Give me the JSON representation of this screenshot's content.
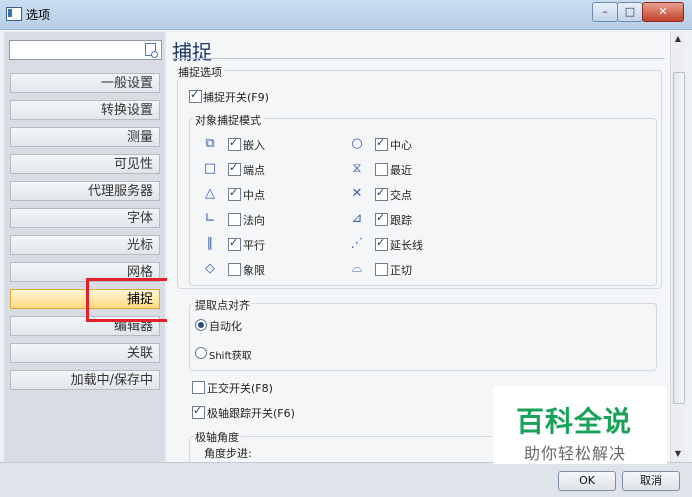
{
  "window": {
    "title": "选项"
  },
  "search": {
    "value": ""
  },
  "sidebar": {
    "items": [
      {
        "label": "一般设置"
      },
      {
        "label": "转换设置"
      },
      {
        "label": "测量"
      },
      {
        "label": "可见性"
      },
      {
        "label": "代理服务器"
      },
      {
        "label": "字体"
      },
      {
        "label": "光标"
      },
      {
        "label": "网格"
      },
      {
        "label": "捕捉",
        "selected": true
      },
      {
        "label": "编辑器"
      },
      {
        "label": "关联"
      },
      {
        "label": "加载中/保存中"
      }
    ]
  },
  "main": {
    "heading": "捕捉",
    "snap_options_group": "捕捉选项",
    "snap_toggle": {
      "label": "捕捉开关(F9)",
      "checked": true
    },
    "object_snap_group": "对象捕捉模式",
    "object_snap_left": [
      {
        "label": "嵌入",
        "checked": true,
        "icon": "embed-icon"
      },
      {
        "label": "端点",
        "checked": true,
        "icon": "endpoint-icon"
      },
      {
        "label": "中点",
        "checked": true,
        "icon": "midpoint-icon"
      },
      {
        "label": "法向",
        "checked": false,
        "icon": "perpendicular-icon"
      },
      {
        "label": "平行",
        "checked": true,
        "icon": "parallel-icon"
      },
      {
        "label": "象限",
        "checked": false,
        "icon": "quadrant-icon"
      }
    ],
    "object_snap_right": [
      {
        "label": "中心",
        "checked": true,
        "icon": "center-icon"
      },
      {
        "label": "最近",
        "checked": false,
        "icon": "nearest-icon"
      },
      {
        "label": "交点",
        "checked": true,
        "icon": "intersection-icon"
      },
      {
        "label": "跟踪",
        "checked": true,
        "icon": "tracking-icon"
      },
      {
        "label": "延长线",
        "checked": true,
        "icon": "extension-icon"
      },
      {
        "label": "正切",
        "checked": false,
        "icon": "tangent-icon"
      }
    ],
    "pick_align_group": "提取点对齐",
    "pick_align_options": [
      {
        "label": "自动化",
        "selected": true
      },
      {
        "label": "Shift获取",
        "selected": false
      }
    ],
    "ortho": {
      "label": "正交开关(F8)",
      "checked": false
    },
    "polar": {
      "label": "极轴跟踪开关(F6)",
      "checked": true
    },
    "polar_angle_group": "极轴角度",
    "angle_step_label": "角度步进:"
  },
  "buttons": {
    "ok": "OK",
    "cancel": "取消"
  },
  "watermark": {
    "main": "百科全说",
    "sub": "助你轻松解决"
  },
  "colors": {
    "accent": "#3a5ea8",
    "selected_bg": "#ffd980",
    "highlight_box": "#e5202a",
    "watermark_green": "#18a25a"
  }
}
